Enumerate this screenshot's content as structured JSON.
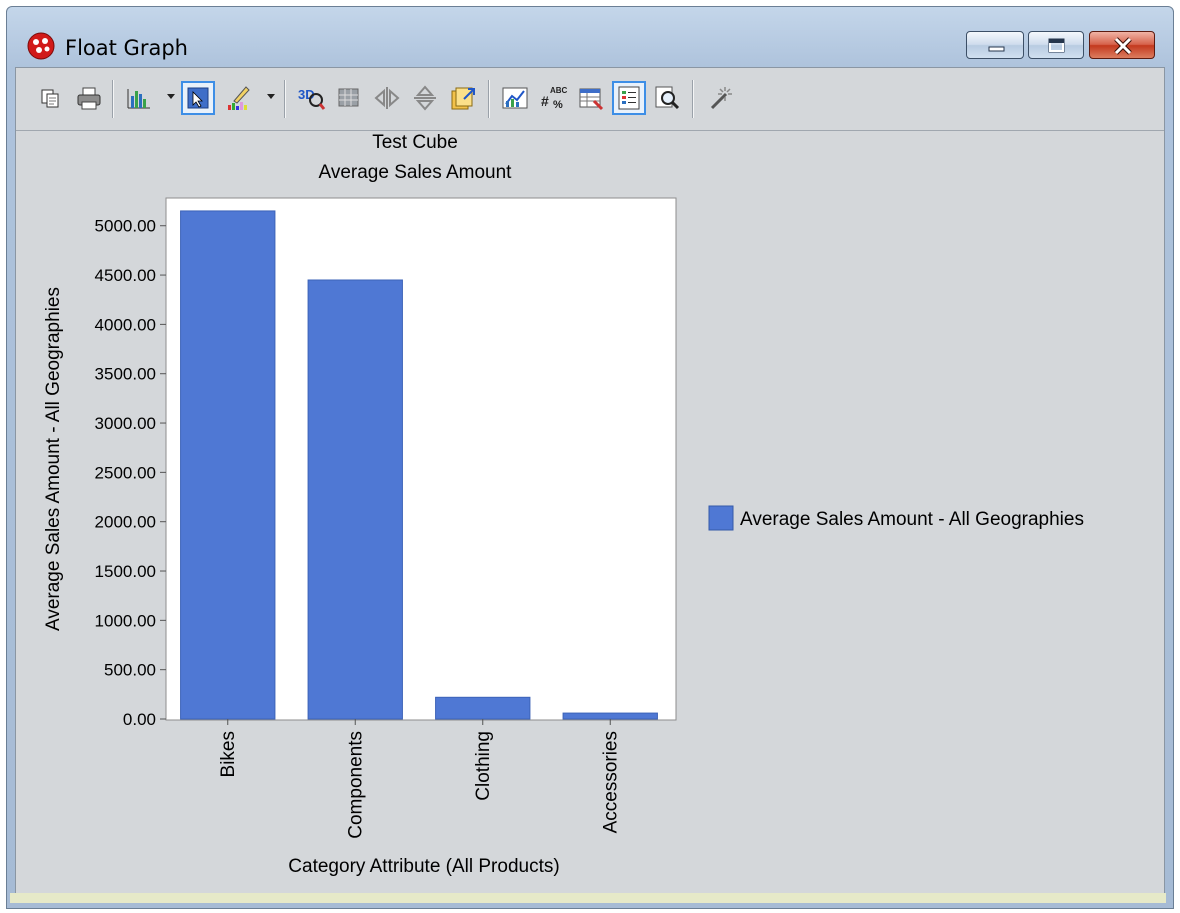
{
  "window": {
    "title": "Float Graph",
    "icons": [
      "app-icon",
      "minimize-icon",
      "maximize-icon",
      "close-icon"
    ]
  },
  "toolbar": {
    "buttons": [
      {
        "name": "copy-icon"
      },
      {
        "name": "print-icon"
      },
      {
        "name": "chart-type-icon",
        "dropdown": true
      },
      {
        "name": "select-pointer-icon",
        "pressed": true
      },
      {
        "name": "color-scheme-icon",
        "dropdown": true
      },
      {
        "name": "3d-view-icon"
      },
      {
        "name": "grid-icon"
      },
      {
        "name": "flip-horizontal-icon"
      },
      {
        "name": "flip-vertical-icon"
      },
      {
        "name": "export-icon"
      },
      {
        "name": "chart-properties-icon"
      },
      {
        "name": "data-labels-icon"
      },
      {
        "name": "data-table-icon"
      },
      {
        "name": "legend-icon",
        "pressed": true
      },
      {
        "name": "zoom-icon"
      },
      {
        "name": "magic-wand-icon"
      }
    ]
  },
  "chart_data": {
    "type": "bar",
    "title": "Test Cube",
    "subtitle": "Average Sales Amount",
    "xlabel": "Category Attribute (All Products)",
    "ylabel": "Average Sales Amount - All Geographies",
    "categories": [
      "Bikes",
      "Components",
      "Clothing",
      "Accessories"
    ],
    "series": [
      {
        "name": "Average Sales Amount - All Geographies",
        "values": [
          5150,
          4450,
          220,
          60
        ],
        "color": "#4f78d4"
      }
    ],
    "ylim": [
      0,
      5200
    ],
    "yticks": [
      "0.00",
      "500.00",
      "1000.00",
      "1500.00",
      "2000.00",
      "2500.00",
      "3000.00",
      "3500.00",
      "4000.00",
      "4500.00",
      "5000.00"
    ],
    "legend_position": "right",
    "grid": false
  }
}
